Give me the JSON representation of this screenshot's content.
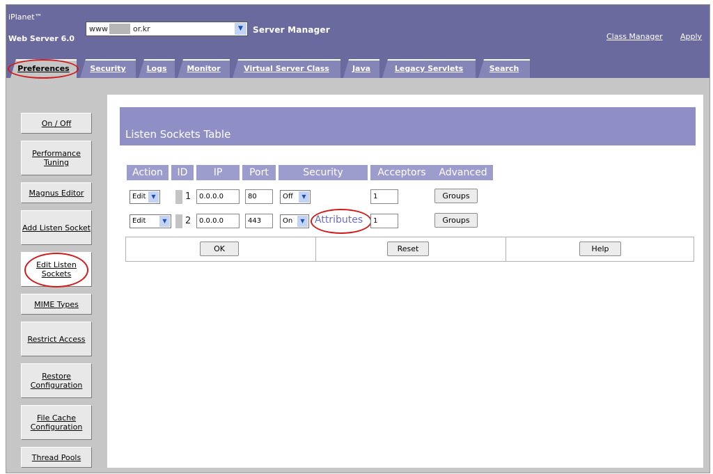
{
  "header": {
    "brand_line1": "iPlanet™",
    "brand_line2": "Web Server 6.0",
    "server_prefix": "www",
    "server_domain": "or.kr",
    "title": "Server Manager",
    "class_manager_link": "Class Manager",
    "apply_link": "Apply"
  },
  "tabs": [
    "Preferences",
    "Security",
    "Logs",
    "Monitor",
    "Virtual Server Class",
    "Java",
    "Legacy Servlets",
    "Search"
  ],
  "nav": [
    "On / Off",
    "Performance Tuning",
    "Magnus Editor",
    "Add Listen Socket",
    "Edit Listen Sockets",
    "MIME Types",
    "Restrict Access",
    "Restore Configuration",
    "File Cache Configuration",
    "Thread Pools"
  ],
  "table": {
    "title": "Listen Sockets Table",
    "headers": [
      "Action",
      "ID",
      "IP",
      "Port",
      "Security",
      "Acceptors",
      "Advanced"
    ],
    "rows": [
      {
        "action": "Edit",
        "id": "1",
        "ip": "0.0.0.0",
        "port": "80",
        "security": "Off",
        "attributes": "",
        "acceptors": "1",
        "advanced": "Groups"
      },
      {
        "action": "Edit",
        "id": "2",
        "ip": "0.0.0.0",
        "port": "443",
        "security": "On",
        "attributes": "Attributes",
        "acceptors": "1",
        "advanced": "Groups"
      }
    ],
    "buttons": {
      "ok": "OK",
      "reset": "Reset",
      "help": "Help"
    }
  },
  "colors": {
    "header_bg": "#6a6a9f",
    "tab_bg": "#8585b8",
    "table_header_bg": "#9c9ccd",
    "highlight_ring": "#d11a1a"
  }
}
